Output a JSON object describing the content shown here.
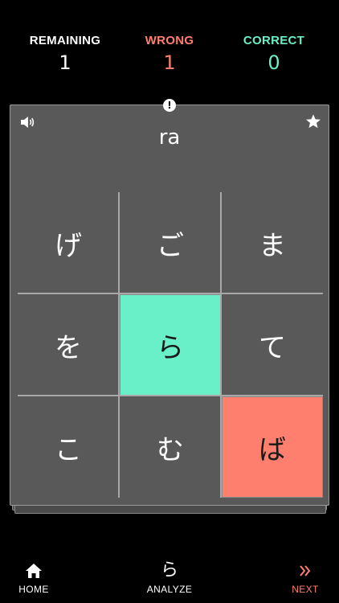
{
  "colors": {
    "background": "#000000",
    "wrong": "#ff7f6e",
    "correct": "#69f0c8",
    "card": "#595959"
  },
  "stats": {
    "remaining": {
      "label": "REMAINING",
      "value": "1",
      "color": "#ffffff"
    },
    "wrong": {
      "label": "WRONG",
      "value": "1",
      "color": "#ff7f6e"
    },
    "correct": {
      "label": "CORRECT",
      "value": "0",
      "color": "#69f0c8"
    }
  },
  "card": {
    "prompt": "ra",
    "sound_icon": "speaker-icon",
    "star_icon": "star-icon",
    "info_icon": "exclamation-info-icon",
    "info_glyph": "!",
    "choices": [
      {
        "char": "げ",
        "state": "default"
      },
      {
        "char": "ご",
        "state": "default"
      },
      {
        "char": "ま",
        "state": "default"
      },
      {
        "char": "を",
        "state": "default"
      },
      {
        "char": "ら",
        "state": "correct"
      },
      {
        "char": "て",
        "state": "default"
      },
      {
        "char": "こ",
        "state": "default"
      },
      {
        "char": "む",
        "state": "default"
      },
      {
        "char": "ば",
        "state": "wrong"
      }
    ]
  },
  "tabbar": {
    "home": {
      "label": "HOME",
      "icon": "home-icon"
    },
    "analyze": {
      "label": "ANALYZE",
      "glyph": "ら"
    },
    "next": {
      "label": "NEXT",
      "icon": "double-chevron-right-icon"
    }
  }
}
